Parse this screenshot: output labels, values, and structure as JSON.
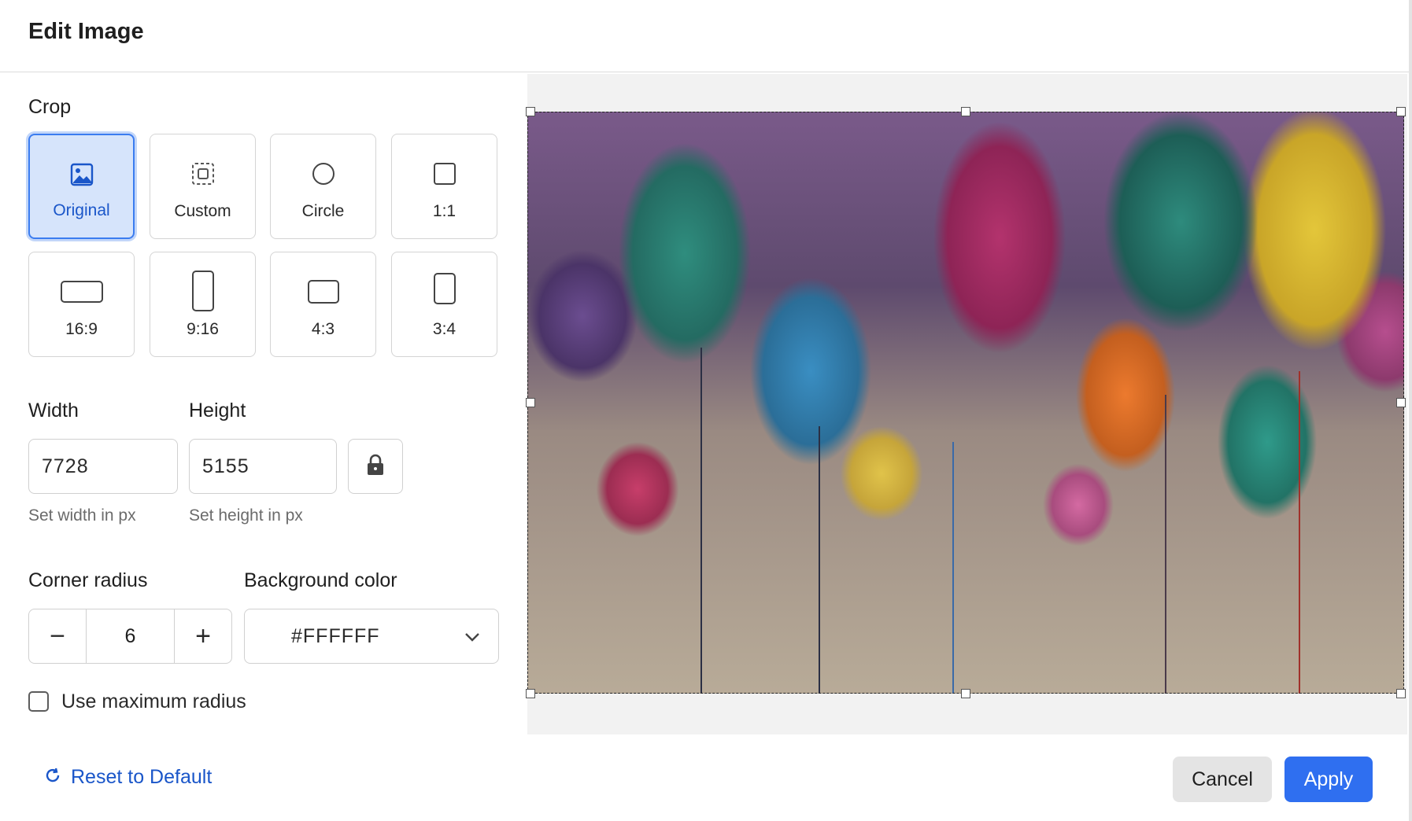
{
  "dialog": {
    "title": "Edit Image"
  },
  "crop": {
    "label": "Crop",
    "options": [
      {
        "label": "Original",
        "icon": "image-icon",
        "active": true
      },
      {
        "label": "Custom",
        "icon": "custom-crop-icon",
        "active": false
      },
      {
        "label": "Circle",
        "icon": "circle-icon",
        "active": false
      },
      {
        "label": "1:1",
        "icon": "square-icon",
        "active": false
      },
      {
        "label": "16:9",
        "icon": "landscape-wide-icon",
        "active": false
      },
      {
        "label": "9:16",
        "icon": "portrait-tall-icon",
        "active": false
      },
      {
        "label": "4:3",
        "icon": "landscape-icon",
        "active": false
      },
      {
        "label": "3:4",
        "icon": "portrait-icon",
        "active": false
      }
    ]
  },
  "size": {
    "width_label": "Width",
    "height_label": "Height",
    "width_value": "7728",
    "height_value": "5155",
    "width_hint": "Set width in px",
    "height_hint": "Set height in px",
    "lock_icon": "lock-icon"
  },
  "corner": {
    "label": "Corner radius",
    "value": "6",
    "minus": "−",
    "plus": "+"
  },
  "background": {
    "label": "Background color",
    "value": "#FFFFFF"
  },
  "max_radius": {
    "label": "Use maximum radius",
    "checked": false
  },
  "footer": {
    "reset_label": "Reset to Default",
    "cancel_label": "Cancel",
    "apply_label": "Apply"
  },
  "colors": {
    "accent": "#2f6ff0",
    "active_bg": "#d6e4fb",
    "link": "#1a56c9"
  }
}
